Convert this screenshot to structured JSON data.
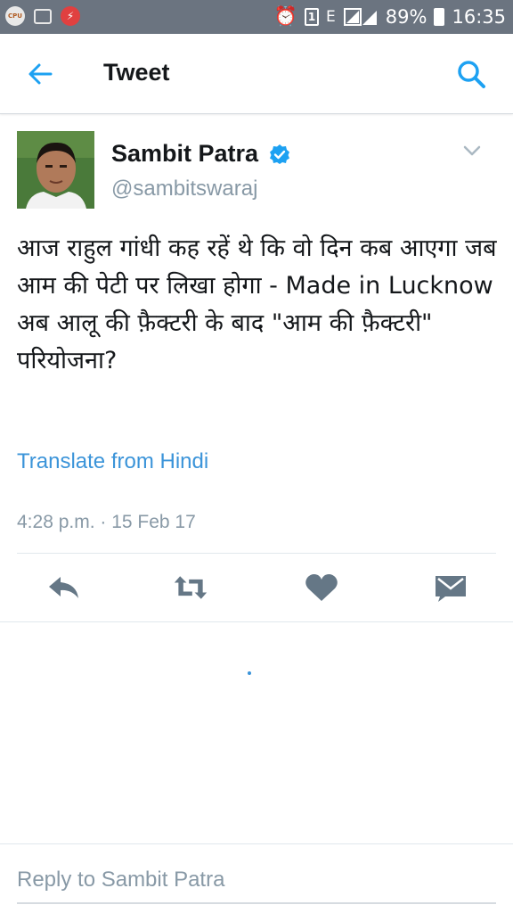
{
  "status_bar": {
    "battery": "89%",
    "time": "16:35",
    "sim_slot": "1",
    "network": "E",
    "icons": [
      "cpu-icon",
      "gallery-icon",
      "flash-icon",
      "alarm-icon",
      "sim-icon",
      "signal-icon",
      "battery-icon"
    ]
  },
  "app_bar": {
    "title": "Tweet",
    "icons": [
      "back-arrow-icon",
      "search-icon"
    ]
  },
  "tweet": {
    "author_name": "Sambit Patra",
    "handle": "@sambitswaraj",
    "verified": true,
    "text": "आज राहुल गांधी कह रहें थे कि वो दिन कब आएगा जब आम की पेटी पर लिखा होगा - Made in Lucknow\nअब आलू की फ़ैक्टरी के बाद \"आम की फ़ैक्टरी\" परियोजना?",
    "translate_label": "Translate from Hindi",
    "timestamp": "4:28 p.m. · 15 Feb 17",
    "actions": [
      "reply-icon",
      "retweet-icon",
      "like-icon",
      "direct-message-icon"
    ]
  },
  "reply": {
    "placeholder": "Reply to Sambit Patra"
  },
  "colors": {
    "status_bar_bg": "#6b7480",
    "accent_blue": "#3b94d9",
    "icon_gray": "#657786",
    "secondary_text": "#8899a6"
  }
}
